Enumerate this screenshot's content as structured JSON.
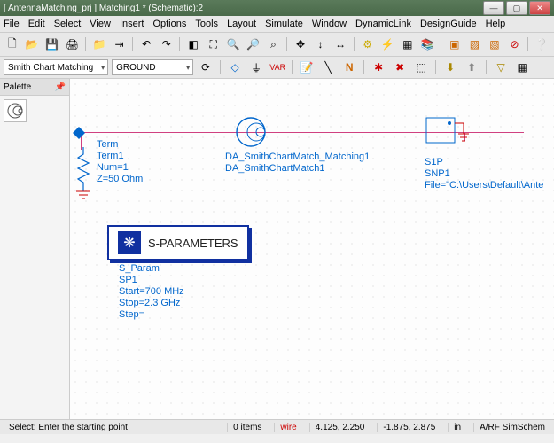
{
  "window": {
    "title": "[ AntennaMatching_prj ] Matching1 * (Schematic):2",
    "min": "—",
    "max": "▢",
    "close": "✕"
  },
  "menu": [
    "File",
    "Edit",
    "Select",
    "View",
    "Insert",
    "Options",
    "Tools",
    "Layout",
    "Simulate",
    "Window",
    "DynamicLink",
    "DesignGuide",
    "Help"
  ],
  "combo1": "Smith Chart Matching",
  "combo2": "GROUND",
  "palette_title": "Palette",
  "term": {
    "l0": "Term",
    "l1": "Term1",
    "l2": "Num=1",
    "l3": "Z=50 Ohm"
  },
  "smith": {
    "l0": "DA_SmithChartMatch_Matching1",
    "l1": "DA_SmithChartMatch1"
  },
  "s1p": {
    "l0": "S1P",
    "l1": "SNP1",
    "l2": "File=\"C:\\Users\\Default\\Ante"
  },
  "sparam_title": "S-PARAMETERS",
  "sp": {
    "l0": "S_Param",
    "l1": "SP1",
    "l2": "Start=700 MHz",
    "l3": "Stop=2.3 GHz",
    "l4": "Step="
  },
  "status": {
    "hint": "Select: Enter the starting point",
    "items": "0 items",
    "mode": "wire",
    "coord1": "4.125, 2.250",
    "coord2": "-1.875, 2.875",
    "units": "in",
    "layout": "A/RF SimSchem"
  }
}
